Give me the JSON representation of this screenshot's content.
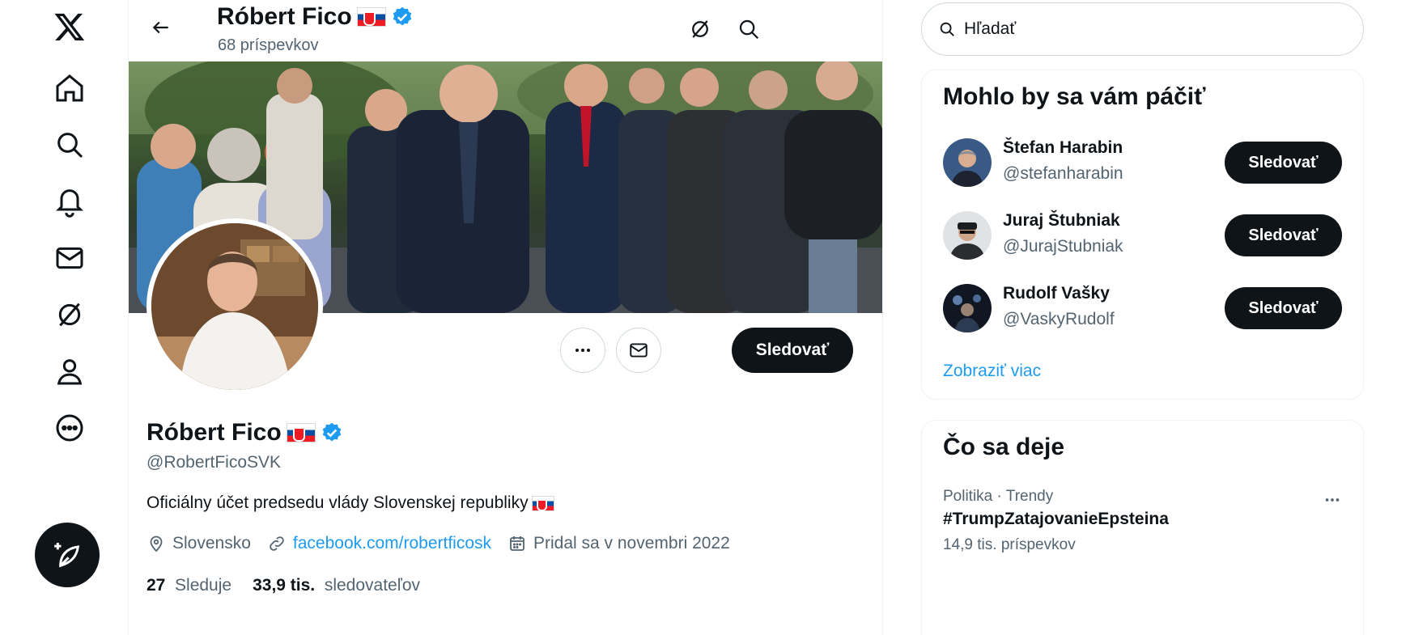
{
  "nav": {
    "items": [
      {
        "name": "x-logo-icon"
      },
      {
        "name": "home-icon"
      },
      {
        "name": "search-icon"
      },
      {
        "name": "notifications-icon"
      },
      {
        "name": "messages-icon"
      },
      {
        "name": "grok-icon"
      },
      {
        "name": "profile-icon"
      },
      {
        "name": "more-icon"
      }
    ],
    "compose_icon": "compose-post-icon"
  },
  "header": {
    "name": "Róbert Fico",
    "post_count": "68 príspevkov"
  },
  "profile": {
    "name": "Róbert Fico",
    "handle": "@RobertFicoSVK",
    "bio": "Oficiálny účet predsedu vlády Slovenskej republiky",
    "location": "Slovensko",
    "website": "facebook.com/robertficosk",
    "joined": "Pridal sa v novembri 2022",
    "following_count": "27",
    "following_label": "Sleduje",
    "followers_count": "33,9 tis.",
    "followers_label": "sledovateľov",
    "follow_label": "Sledovať"
  },
  "search": {
    "placeholder": "Hľadať"
  },
  "suggestions": {
    "title": "Mohlo by sa vám páčiť",
    "users": [
      {
        "name": "Štefan Harabin",
        "handle": "@stefanharabin",
        "button": "Sledovať"
      },
      {
        "name": "Juraj Štubniak",
        "handle": "@JurajStubniak",
        "button": "Sledovať"
      },
      {
        "name": "Rudolf Vašky",
        "handle": "@VaskyRudolf",
        "button": "Sledovať"
      }
    ],
    "show_more": "Zobraziť viac"
  },
  "trends": {
    "title": "Čo sa deje",
    "items": [
      {
        "meta": "Politika · Trendy",
        "name": "#TrumpZatajovanieEpsteina",
        "count": "14,9 tis. príspevkov"
      }
    ]
  },
  "colors": {
    "accent": "#1d9bf0",
    "button_dark": "#0f1419",
    "secondary_text": "#536471"
  }
}
